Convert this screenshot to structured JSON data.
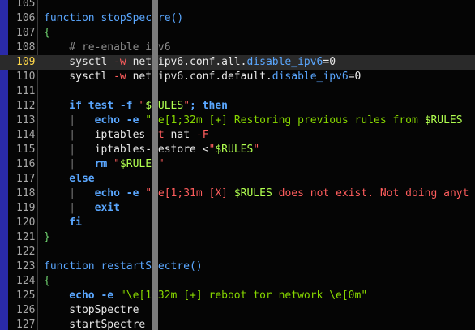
{
  "editor": {
    "lines": [
      {
        "n": "105",
        "segs": []
      },
      {
        "n": "106",
        "segs": [
          {
            "t": "function stopSpectre()",
            "c": "fn"
          }
        ]
      },
      {
        "n": "107",
        "segs": [
          {
            "t": "{",
            "c": "brace"
          }
        ]
      },
      {
        "n": "108",
        "segs": [
          {
            "t": "    # re-enable ipv6",
            "c": "cmt"
          }
        ]
      },
      {
        "n": "109",
        "current": true,
        "segs": [
          {
            "t": "    sysctl ",
            "c": ""
          },
          {
            "t": "-w",
            "c": "flag"
          },
          {
            "t": " net.ipv6.conf.all.",
            "c": ""
          },
          {
            "t": "disable_ipv6",
            "c": "attr"
          },
          {
            "t": "=0",
            "c": ""
          }
        ]
      },
      {
        "n": "110",
        "segs": [
          {
            "t": "    sysctl ",
            "c": ""
          },
          {
            "t": "-w",
            "c": "flag"
          },
          {
            "t": " net.ipv6.conf.default.",
            "c": ""
          },
          {
            "t": "disable_ipv6",
            "c": "attr"
          },
          {
            "t": "=0",
            "c": ""
          }
        ]
      },
      {
        "n": "111",
        "segs": []
      },
      {
        "n": "112",
        "segs": [
          {
            "t": "    if test -f ",
            "c": "kw"
          },
          {
            "t": "\"",
            "c": "str"
          },
          {
            "t": "$RULES",
            "c": "var"
          },
          {
            "t": "\"",
            "c": "str"
          },
          {
            "t": "; then",
            "c": "kw"
          }
        ]
      },
      {
        "n": "113",
        "segs": [
          {
            "t": "    |   ",
            "c": "guide"
          },
          {
            "t": "echo -e ",
            "c": "kw"
          },
          {
            "t": "\"\\e[1;32m [+] Restoring previous rules from ",
            "c": "ok"
          },
          {
            "t": "$RULES",
            "c": "var"
          }
        ]
      },
      {
        "n": "114",
        "segs": [
          {
            "t": "    |   ",
            "c": "guide"
          },
          {
            "t": "iptables ",
            "c": ""
          },
          {
            "t": "-t",
            "c": "flag"
          },
          {
            "t": " nat ",
            "c": ""
          },
          {
            "t": "-F",
            "c": "flag"
          }
        ]
      },
      {
        "n": "115",
        "segs": [
          {
            "t": "    |   ",
            "c": "guide"
          },
          {
            "t": "iptables-restore <",
            "c": ""
          },
          {
            "t": "\"",
            "c": "str"
          },
          {
            "t": "$RULES",
            "c": "var"
          },
          {
            "t": "\"",
            "c": "str"
          }
        ]
      },
      {
        "n": "116",
        "segs": [
          {
            "t": "    |   ",
            "c": "guide"
          },
          {
            "t": "rm ",
            "c": "kw"
          },
          {
            "t": "\"",
            "c": "str"
          },
          {
            "t": "$RULES",
            "c": "var"
          },
          {
            "t": "\"",
            "c": "str"
          }
        ]
      },
      {
        "n": "117",
        "segs": [
          {
            "t": "    else",
            "c": "kw"
          }
        ]
      },
      {
        "n": "118",
        "segs": [
          {
            "t": "    |   ",
            "c": "guide"
          },
          {
            "t": "echo -e ",
            "c": "kw"
          },
          {
            "t": "\"\\e[1;31m [X] ",
            "c": "str"
          },
          {
            "t": "$RULES",
            "c": "var"
          },
          {
            "t": " does not exist. Not doing anyt",
            "c": "str"
          }
        ]
      },
      {
        "n": "119",
        "segs": [
          {
            "t": "    |   ",
            "c": "guide"
          },
          {
            "t": "exit",
            "c": "kw"
          }
        ]
      },
      {
        "n": "120",
        "segs": [
          {
            "t": "    fi",
            "c": "kw"
          }
        ]
      },
      {
        "n": "121",
        "segs": [
          {
            "t": "}",
            "c": "brace"
          }
        ]
      },
      {
        "n": "122",
        "segs": []
      },
      {
        "n": "123",
        "segs": [
          {
            "t": "function restartSpectre()",
            "c": "fn"
          }
        ]
      },
      {
        "n": "124",
        "segs": [
          {
            "t": "{",
            "c": "brace"
          }
        ]
      },
      {
        "n": "125",
        "segs": [
          {
            "t": "    echo -e ",
            "c": "kw"
          },
          {
            "t": "\"\\e[1;32m [+] reboot tor network \\e[0m\"",
            "c": "ok"
          }
        ]
      },
      {
        "n": "126",
        "segs": [
          {
            "t": "    stopSpectre",
            "c": ""
          }
        ]
      },
      {
        "n": "127",
        "segs": [
          {
            "t": "    startSpectre",
            "c": ""
          }
        ]
      }
    ]
  }
}
